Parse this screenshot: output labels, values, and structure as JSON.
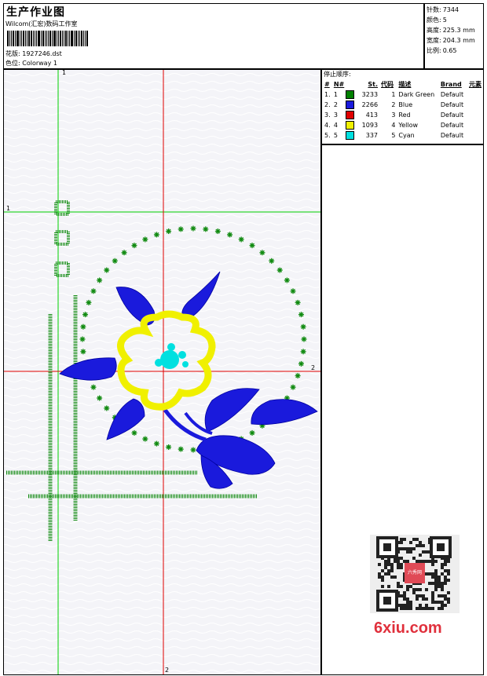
{
  "header": {
    "title": "生产作业图",
    "subtitle": "Wilcom(汇宏)数码工作室",
    "design_label": "花版:",
    "design_value": "1927246.dst",
    "colorway_label": "色位:",
    "colorway_value": "Colorway 1"
  },
  "stats": {
    "stitches_label": "针数:",
    "stitches": "7344",
    "colors_label": "颜色:",
    "colors": "5",
    "height_label": "高度:",
    "height": "225.3 mm",
    "width_label": "宽度:",
    "width": "204.3 mm",
    "scale_label": "比例:",
    "scale": "0.65"
  },
  "colortable": {
    "label": "停止顺序:",
    "headers": [
      "#",
      "N#",
      "St.",
      "代码",
      "描述",
      "Brand",
      "元素"
    ],
    "rows": [
      {
        "num": "1.",
        "n": "1",
        "color": "#008000",
        "st": "3233",
        "code": "1",
        "desc": "Dark Green",
        "brand": "Default"
      },
      {
        "num": "2.",
        "n": "2",
        "color": "#1a1adc",
        "st": "2266",
        "code": "2",
        "desc": "Blue",
        "brand": "Default"
      },
      {
        "num": "3.",
        "n": "3",
        "color": "#e00000",
        "st": "413",
        "code": "3",
        "desc": "Red",
        "brand": "Default"
      },
      {
        "num": "4.",
        "n": "4",
        "color": "#f0f000",
        "st": "1093",
        "code": "4",
        "desc": "Yellow",
        "brand": "Default"
      },
      {
        "num": "5.",
        "n": "5",
        "color": "#00e0e0",
        "st": "337",
        "code": "5",
        "desc": "Cyan",
        "brand": "Default"
      }
    ]
  },
  "guides": {
    "green_v_label": "1",
    "green_h_label": "1",
    "red_v_label": "2",
    "red_h_label": "2"
  },
  "watermark": {
    "text": "6xiu.com",
    "qr_stamp": "六秀网"
  }
}
